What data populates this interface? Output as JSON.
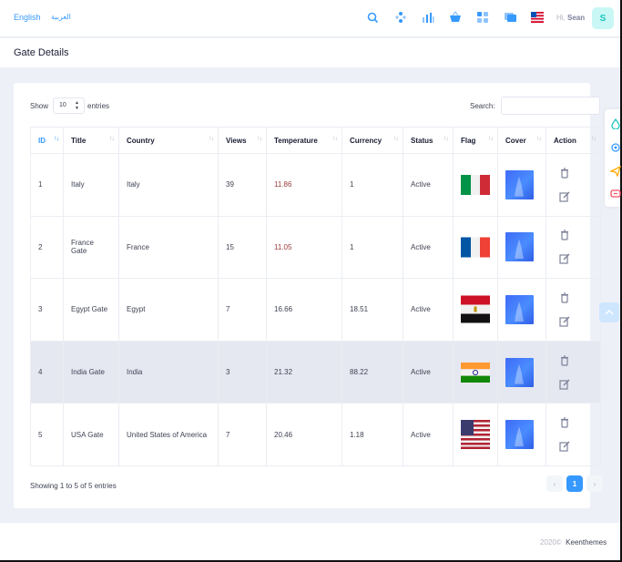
{
  "header": {
    "lang_en": "English",
    "lang_ar": "العربية",
    "greeting": "Hi,",
    "user_name": "Sean",
    "avatar_initial": "S",
    "icons": [
      "search-icon",
      "layers-icon",
      "chart-icon",
      "basket-icon",
      "apps-icon",
      "chat-icon",
      "us-flag-icon"
    ]
  },
  "subheader": {
    "title": "Gate Details"
  },
  "table_controls": {
    "show_label": "Show",
    "entries_value": "10",
    "entries_label": "entries",
    "search_label": "Search:",
    "search_value": ""
  },
  "table": {
    "columns": [
      "ID",
      "Title",
      "Country",
      "Views",
      "Temperature",
      "Currency",
      "Status",
      "Flag",
      "Cover",
      "Action"
    ],
    "rows": [
      {
        "id": "1",
        "title": "Italy",
        "country": "Italy",
        "views": "39",
        "temperature": "11.86",
        "currency": "1",
        "status": "Active",
        "flag": "italy"
      },
      {
        "id": "2",
        "title": "France Gate",
        "country": "France",
        "views": "15",
        "temperature": "11.05",
        "currency": "1",
        "status": "Active",
        "flag": "france"
      },
      {
        "id": "3",
        "title": "Egypt Gate",
        "country": "Egypt",
        "views": "7",
        "temperature": "16.66",
        "currency": "18.51",
        "status": "Active",
        "flag": "egypt"
      },
      {
        "id": "4",
        "title": "India Gate",
        "country": "India",
        "views": "3",
        "temperature": "21.32",
        "currency": "88.22",
        "status": "Active",
        "flag": "india"
      },
      {
        "id": "5",
        "title": "USA Gate",
        "country": "United States of America",
        "views": "7",
        "temperature": "20.46",
        "currency": "1.18",
        "status": "Active",
        "flag": "usa"
      }
    ]
  },
  "pagination": {
    "info": "Showing 1 to 5 of 5 entries",
    "prev": "‹",
    "current": "1",
    "next": "›"
  },
  "footer": {
    "year": "2020©",
    "brand": "Keenthemes"
  },
  "colors": {
    "primary": "#3699ff",
    "highlight_row": "#e6e8f1",
    "avatar_bg": "#c9f7f5",
    "avatar_fg": "#1bc5bd"
  }
}
